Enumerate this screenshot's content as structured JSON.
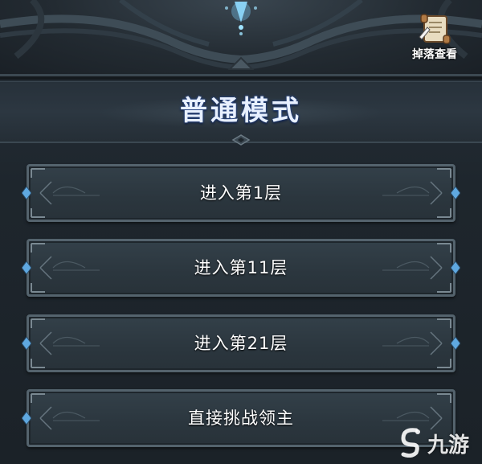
{
  "header": {
    "loot_button_label": "掉落查看",
    "loot_icon": "scroll-icon"
  },
  "mode": {
    "title": "普通模式"
  },
  "floor_buttons": [
    {
      "label": "进入第1层"
    },
    {
      "label": "进入第11层"
    },
    {
      "label": "进入第21层"
    },
    {
      "label": "直接挑战领主"
    }
  ],
  "watermark": {
    "text": "九游",
    "icon": "jiuyou-logo-icon"
  },
  "colors": {
    "background": "#1c2329",
    "button_fill": "#2e3a42",
    "button_border": "#54636d",
    "gem_accent": "#5fa8e0",
    "title_text": "#e8f0ff",
    "crest_glow": "#7fd0ff"
  }
}
